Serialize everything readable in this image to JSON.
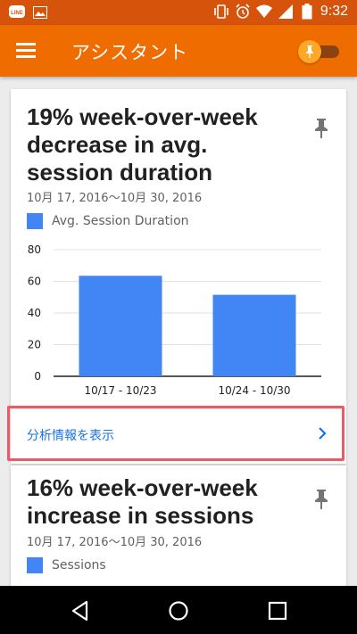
{
  "statusbar": {
    "time": "9:32",
    "icons": [
      "line-icon",
      "image-icon",
      "vibrate-icon",
      "alarm-icon",
      "wifi-icon",
      "signal-icon",
      "battery-icon"
    ]
  },
  "appbar": {
    "title": "アシスタント",
    "icons": [
      "menu-icon",
      "pin-toggle-icon"
    ]
  },
  "cards": [
    {
      "title": "19% week-over-week decrease in avg. session duration",
      "date_range": "10月 17, 2016〜10月 30, 2016",
      "legend_label": "Avg. Session Duration",
      "link_label": "分析情報を表示"
    },
    {
      "title": "16% week-over-week increase in sessions",
      "date_range": "10月 17, 2016〜10月 30, 2016",
      "legend_label": "Sessions"
    }
  ],
  "chart_data": {
    "type": "bar",
    "categories": [
      "10/17 - 10/23",
      "10/24 - 10/30"
    ],
    "series": [
      {
        "name": "Avg. Session Duration",
        "values": [
          63.5,
          51.5
        ]
      }
    ],
    "ylim": [
      0,
      80
    ],
    "yticks": [
      "0",
      "20",
      "40",
      "60",
      "80"
    ],
    "grid": true,
    "legend_position": "top-left",
    "color": "#4285f4"
  },
  "colors": {
    "statusbar": "#d6530b",
    "appbar": "#ef6c00",
    "accent": "#4285f4",
    "link": "#1a73e8",
    "highlight": "#ec5a6a"
  }
}
